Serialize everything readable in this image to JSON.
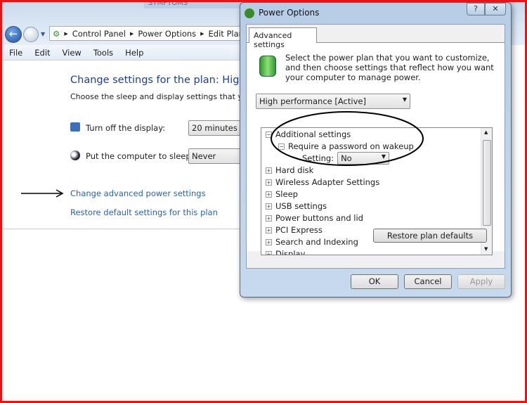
{
  "background_window": {
    "title": "SYMPTOMS"
  },
  "explorer": {
    "breadcrumb": [
      "Control Panel",
      "Power Options",
      "Edit Plan S"
    ],
    "menu": [
      "File",
      "Edit",
      "View",
      "Tools",
      "Help"
    ],
    "title": "Change settings for the plan: High pe",
    "subtitle": "Choose the sleep and display settings that you w",
    "display_label": "Turn off the display:",
    "display_value": "20 minutes",
    "sleep_label": "Put the computer to sleep:",
    "sleep_value": "Never",
    "advanced_link": "Change advanced power settings",
    "restore_link": "Restore default settings for this plan"
  },
  "dialog": {
    "title": "Power Options",
    "help": "?",
    "close": "✕",
    "tab": "Advanced settings",
    "description": "Select the power plan that you want to customize, and then choose settings that reflect how you want your computer to manage power.",
    "plan": "High performance [Active]",
    "tree": {
      "root": "Additional settings",
      "child": "Require a password on wakeup",
      "setting_label": "Setting:",
      "setting_value": "No",
      "items": [
        "Hard disk",
        "Wireless Adapter Settings",
        "Sleep",
        "USB settings",
        "Power buttons and lid",
        "PCI Express",
        "Search and Indexing",
        "Display"
      ]
    },
    "restore": "Restore plan defaults",
    "ok": "OK",
    "cancel": "Cancel",
    "apply": "Apply"
  },
  "colors": {
    "annotation_border": "#e11111",
    "link": "#2a63a8",
    "heading": "#1e3f8a"
  }
}
